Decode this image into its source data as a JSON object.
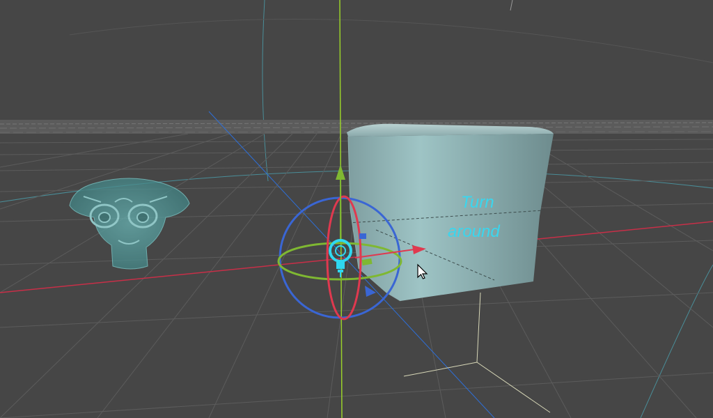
{
  "viewport": {
    "background": "#464646",
    "horizon_color": "#5a5a5a",
    "grid_color": "#5e5e5e",
    "axis_x_color": "#d0304a",
    "axis_y_color": "#9ad12a",
    "axis_z_color": "#2e6fd8",
    "light_color": "#2fd8f0"
  },
  "cube": {
    "text_line1": "Turn",
    "text_line2": "around",
    "text_color": "#3ad6ee",
    "face_color": "#8fb5b8"
  },
  "suzanne": {
    "color": "#5fa9aa"
  },
  "gizmo": {
    "x_color": "#e0394f",
    "y_color": "#7fb832",
    "z_color": "#3a66d4"
  },
  "cursor": {
    "icon": "arrow-pointer-icon"
  }
}
